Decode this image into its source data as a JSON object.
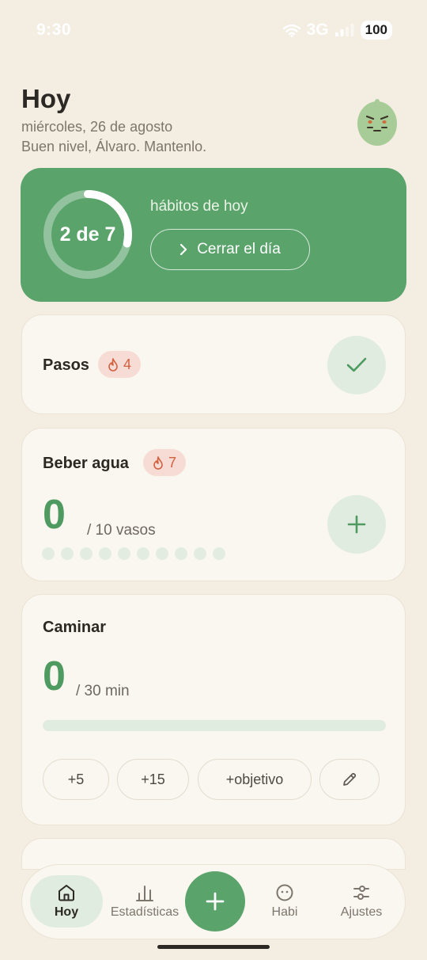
{
  "status": {
    "time": "9:30",
    "network": "3G",
    "battery": "100"
  },
  "header": {
    "title": "Hoy",
    "date": "miércoles, 26 de agosto",
    "subtitle": "Buen nivel, Álvaro. Mantenlo."
  },
  "summary": {
    "ring_label": "2 de 7",
    "done": 2,
    "total": 7,
    "caption": "hábitos de hoy",
    "close_day_label": "Cerrar el día"
  },
  "habits": [
    {
      "name": "Pasos",
      "streak": "4",
      "status": "completed"
    },
    {
      "name": "Beber agua",
      "streak": "7",
      "value": "0",
      "unit": "/ 10 vasos",
      "dots": 10
    },
    {
      "name": "Caminar",
      "value": "0",
      "unit": "/ 30 min",
      "progress": 0,
      "actions": [
        "+5",
        "+15",
        "+objetivo"
      ]
    }
  ],
  "nav": {
    "items": [
      {
        "label": "Hoy",
        "icon": "home-icon",
        "active": true
      },
      {
        "label": "Estadísticas",
        "icon": "bar-chart-icon"
      },
      {
        "label": "Habi",
        "icon": "face-icon"
      },
      {
        "label": "Ajustes",
        "icon": "sliders-icon"
      }
    ],
    "fab_icon": "plus-icon"
  },
  "colors": {
    "accent": "#5aa36b",
    "accent_dark": "#4f9a60",
    "background": "#f3ede2",
    "card": "#faf7f0",
    "streak_bg": "#f6dcd4",
    "streak_text": "#d1613f"
  }
}
